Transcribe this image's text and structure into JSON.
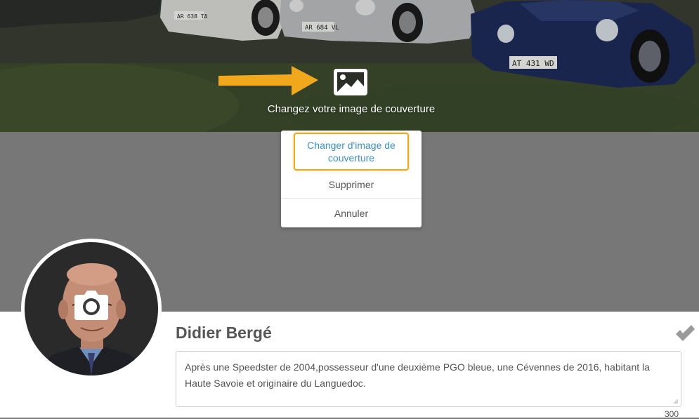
{
  "cover": {
    "caption": "Changez votre image de couverture",
    "icon": "image-icon",
    "plates": [
      "AR 684 VL",
      "AT 431 WD",
      "AR 638 TA"
    ]
  },
  "menu": {
    "items": [
      {
        "label": "Changer d'image de couverture",
        "highlighted": true
      },
      {
        "label": "Supprimer"
      },
      {
        "label": "Annuler"
      }
    ]
  },
  "profile": {
    "name": "Didier Bergé",
    "camera_icon": "camera-icon",
    "confirm_icon": "check-icon",
    "bio": "Après une Speedster de 2004,possesseur d'une deuxième PGO bleue,  une Cévennes de 2016, habitant la Haute Savoie et originaire du Languedoc.",
    "char_counter": "300"
  },
  "colors": {
    "accent_orange": "#f2a81d",
    "link_blue": "#3a8fd0",
    "text_grey": "#555555",
    "band_grey": "#777777"
  }
}
